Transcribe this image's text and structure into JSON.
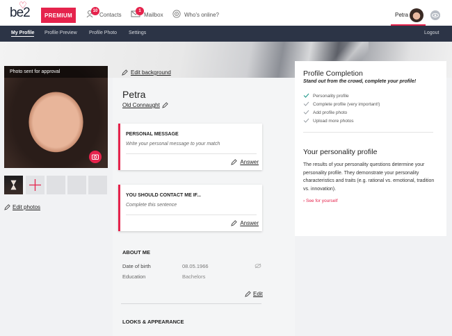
{
  "header": {
    "logo_text": "be2",
    "premium_label": "PREMIUM",
    "contacts_label": "Contacts",
    "contacts_badge": "10",
    "mailbox_label": "Mailbox",
    "mailbox_badge": "1",
    "whos_online_label": "Who's online?",
    "user_name": "Petra"
  },
  "subnav": {
    "items": [
      "My Profile",
      "Profile Preview",
      "Profile Photo",
      "Settings"
    ],
    "logout": "Logout"
  },
  "profile": {
    "edit_background": "Edit background",
    "photo_status": "Photo sent for approval",
    "edit_photos": "Edit photos",
    "name": "Petra",
    "city": "Old Connaught"
  },
  "cards": [
    {
      "title": "PERSONAL MESSAGE",
      "placeholder": "Write your personal message to your match",
      "action": "Answer"
    },
    {
      "title": "YOU SHOULD CONTACT ME IF...",
      "placeholder": "Complete this sentence",
      "action": "Answer"
    }
  ],
  "about": {
    "title": "ABOUT ME",
    "dob_label": "Date of birth",
    "dob_value": "08.05.1966",
    "education_label": "Education",
    "education_value": "Bachelors",
    "edit": "Edit"
  },
  "looks": {
    "title": "LOOKS & APPEARANCE"
  },
  "completion": {
    "title": "Profile Completion",
    "subtitle": "Stand out from the crowd, complete your profile!",
    "items": [
      {
        "label": "Personality profile",
        "done": true
      },
      {
        "label": "Complete profile (very important!)",
        "done": false
      },
      {
        "label": "Add profile photo",
        "done": false
      },
      {
        "label": "Upload more photos",
        "done": false
      }
    ]
  },
  "personality": {
    "title": "Your personality profile",
    "description": "The results of your personality questions determine your personality profile. They demonstrate your personality characteristics and traits (e.g. rational vs. emotional, tradition vs. innovation).",
    "link": "See for yourself"
  },
  "colors": {
    "accent": "#e5234c",
    "navbar": "#2c3446",
    "check_done": "#2a9d8f",
    "check_pending": "#9aa0a6"
  }
}
